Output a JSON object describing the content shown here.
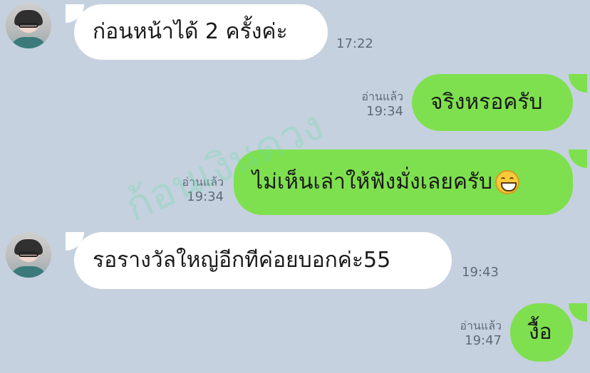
{
  "messages": [
    {
      "text": "ก่อนหน้าได้ 2 ครั้งค่ะ",
      "time": "17:22"
    },
    {
      "text": "จริงหรอครับ",
      "read": "อ่านแล้ว",
      "time": "19:34"
    },
    {
      "text": "ไม่เห็นเล่าให้ฟังมั่งเลยครับ",
      "emoji": "grinning-face",
      "read": "อ่านแล้ว",
      "time": "19:34"
    },
    {
      "text": "รอรางวัลใหญ่อีกทีค่อยบอกค่ะ55",
      "time": "19:43"
    },
    {
      "text": "งื้อ",
      "read": "อ่านแล้ว",
      "time": "19:47"
    }
  ],
  "watermark": "ก้อนเงินดวง",
  "colors": {
    "background": "#c5d1de",
    "outgoing": "#7ee04e",
    "incoming": "#ffffff"
  }
}
